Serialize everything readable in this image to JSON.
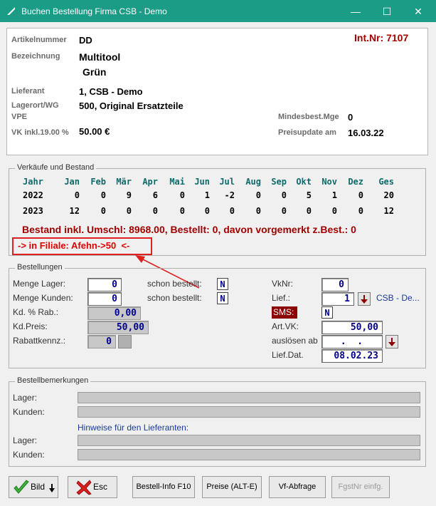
{
  "window": {
    "title": "Buchen Bestellung Firma CSB - Demo",
    "minimize": "—",
    "maximize": "☐",
    "close": "✕"
  },
  "article": {
    "artikelnummer_label": "Artikelnummer",
    "artikelnummer": "DD",
    "int_nr": "Int.Nr: 7107",
    "bezeichnung_label": "Bezeichnung",
    "bezeichnung_line1": "Multitool",
    "bezeichnung_line2": "Grün",
    "lieferant_label": "Lieferant",
    "lieferant": "1, CSB - Demo",
    "lagerort_label": "Lagerort/WG",
    "lagerort": "500, Original Ersatzteile",
    "vpe_label": "VPE",
    "mindestbest_label": "Mindesbest.Mge",
    "mindestbest": "0",
    "vk_label": "VK inkl.19.00 %",
    "vk": "50.00 €",
    "preisupdate_label": "Preisupdate am",
    "preisupdate": "16.03.22"
  },
  "sales": {
    "group_title": "Verkäufe und Bestand",
    "headers": [
      "Jahr",
      "Jan",
      "Feb",
      "Mär",
      "Apr",
      "Mai",
      "Jun",
      "Jul",
      "Aug",
      "Sep",
      "Okt",
      "Nov",
      "Dez",
      "Ges"
    ],
    "rows": [
      [
        "2022",
        "0",
        "0",
        "9",
        "6",
        "0",
        "1",
        "-2",
        "0",
        "0",
        "5",
        "1",
        "0",
        "20"
      ],
      [
        "2023",
        "12",
        "0",
        "0",
        "0",
        "0",
        "0",
        "0",
        "0",
        "0",
        "0",
        "0",
        "0",
        "12"
      ]
    ],
    "bestand_text": "Bestand inkl. Umschl: 8968.00, Bestellt: 0, davon vorgemerkt z.Best.: 0",
    "filiale_text": "-> in Filiale: Afehn->50  <-"
  },
  "orders": {
    "group_title": "Bestellungen",
    "menge_lager_label": "Menge Lager:",
    "menge_lager": "0",
    "schon_bestellt_label_1": "schon bestellt:",
    "schon_bestellt_1": "N",
    "menge_kunden_label": "Menge Kunden:",
    "menge_kunden": "0",
    "schon_bestellt_label_2": "schon bestellt:",
    "schon_bestellt_2": "N",
    "kd_rab_label": "Kd. % Rab.:",
    "kd_rab": "0,00",
    "kd_preis_label": "Kd.Preis:",
    "kd_preis": "50,00",
    "rabattkennz_label": "Rabattkennz.:",
    "rabattkennz": "0",
    "vknr_label": "VkNr:",
    "vknr": "0",
    "lief_label": "Lief.:",
    "lief": "1",
    "lief_name": "CSB - De...",
    "sms_label": "SMS:",
    "sms": "N",
    "art_vk_label": "Art.VK:",
    "art_vk": "50,00",
    "ausloesen_label": "auslösen ab",
    "ausloesen": " .  .",
    "lief_dat_label": "Lief.Dat.",
    "lief_dat": "08.02.23"
  },
  "remarks": {
    "group_title": "Bestellbemerkungen",
    "lager_label": "Lager:",
    "kunden_label": "Kunden:",
    "hinweise_label": "Hinweise für den Lieferanten:",
    "lager2_label": "Lager:",
    "kunden2_label": "Kunden:"
  },
  "buttons": {
    "bild": "Bild",
    "esc": "Esc",
    "bestell_info": "Bestell-Info F10",
    "preise": "Preise (ALT-E)",
    "vf_abfrage": "Vf-Abfrage",
    "fgstnr": "FgstNr einfg."
  },
  "colors": {
    "titlebar": "#1a9c86",
    "accent_red": "#a00000",
    "field_blue": "#00008b"
  }
}
